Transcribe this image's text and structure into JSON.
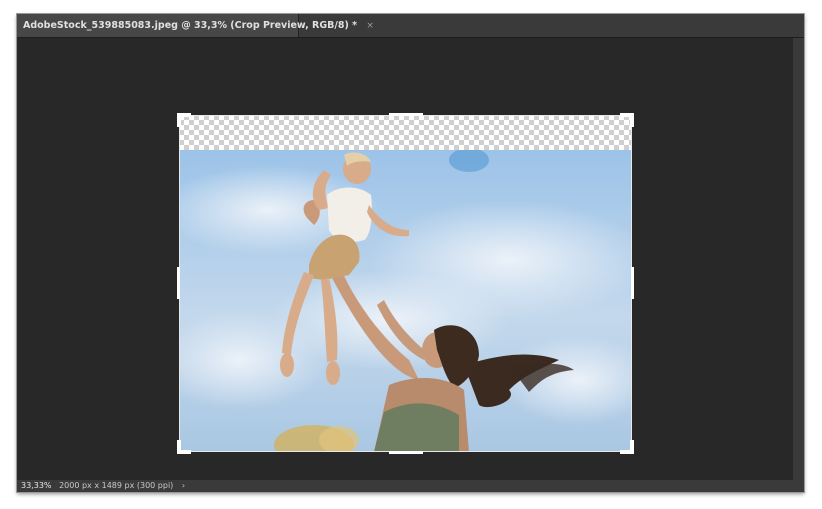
{
  "document_tab": {
    "title": "AdobeStock_539885083.jpeg @ 33,3% (Crop Preview, RGB/8) *",
    "close_glyph": "×"
  },
  "status_bar": {
    "zoom": "33,33%",
    "doc_info": "2000 px x 1489 px (300 ppi)",
    "menu_glyph": "›"
  },
  "canvas": {
    "background_color": "#282828",
    "image_description_icon": "photo-mother-lifting-child"
  },
  "crop": {
    "border_color": "#e8e8e8",
    "handle_color": "#ffffff"
  }
}
